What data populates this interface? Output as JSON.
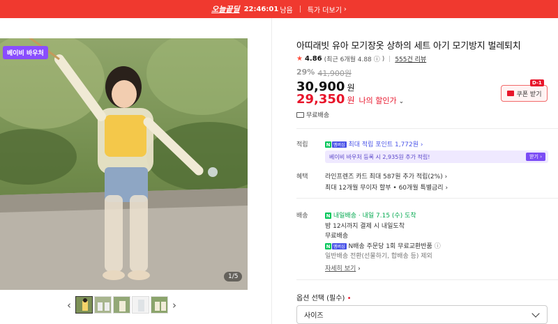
{
  "topbar": {
    "logo": "오늘끝딜",
    "timer": "22:46:01",
    "timer_suffix": "남음",
    "more_label": "특가 더보기",
    "more_chevron": "›"
  },
  "gallery": {
    "voucher_badge": "베이비 바우처",
    "counter": "1/5",
    "prev": "‹",
    "next": "›",
    "thumb_count": 5
  },
  "product": {
    "title": "아띠래빗 유아 모기장옷 상하의 세트 아기 모기방지 벌레퇴치",
    "rating": {
      "star": "★",
      "score": "4.86",
      "recent": "(최근 6개월 4.88",
      "info": "ⓘ",
      "recent_close": ")",
      "reviews": "555건 리뷰"
    },
    "discount_rate": "29%",
    "original_price": "41,900원",
    "price": "30,900",
    "price_unit": "원",
    "my_price": "29,350",
    "my_price_unit": "원",
    "my_price_label": "나의 할인가",
    "my_price_chevron": "⌄",
    "coupon_label": "쿠폰 받기",
    "dday": "D-1",
    "free_shipping": "무료배송"
  },
  "benefits": {
    "points_label": "적립",
    "points_text": "최대 적립 포인트 1,772원",
    "points_chevron": "›",
    "voucher_text": "베이비 바우처 등록 시 2,935원 추가 적립!",
    "voucher_button": "받기 ›",
    "perks_label": "혜택",
    "perk1": "라인프렌즈 카드 최대 587원 추가 적립(2%)",
    "perk1_chevron": "›",
    "perk2": "최대 12개월 무이자 할부 • 60개월 특별금리",
    "perk2_chevron": "›"
  },
  "delivery": {
    "label": "배송",
    "tomorrow_badge": "내일배송",
    "arrival": "· 내일 7.15 (수) 도착",
    "cutoff": "밤 12시까지 결제 시 내일도착",
    "free": "무료배송",
    "exchange": "N배송 주문당 1회 무료교환반품",
    "exchange_info": "ⓘ",
    "exclude": "일반배송 전환(선물하기, 합배송 등) 제외",
    "more": "자세히 보기",
    "more_chevron": "›"
  },
  "npay": {
    "n": "N",
    "m": "멤버십"
  },
  "option": {
    "label": "옵션 선택 (필수)",
    "required_mark": "•",
    "select_value": "사이즈"
  },
  "colors": {
    "brand_red": "#f0392f",
    "sale_red": "#e8152b",
    "naver_green": "#03c75a",
    "membership_blue": "#4a54e8",
    "voucher_purple": "#8a4dff"
  }
}
